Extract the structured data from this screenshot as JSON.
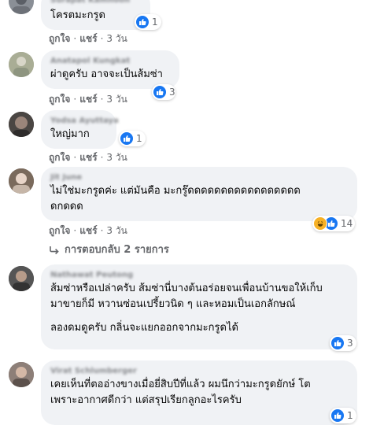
{
  "reactions_icon": "like-icon",
  "colors": {
    "like": "#1877f2",
    "bubble": "#f0f2f5",
    "meta": "#65676b"
  },
  "actions": {
    "like": "ถูกใจ",
    "reply": "แชร์",
    "separator": "·"
  },
  "comments": [
    {
      "name": "Surapat Kamnoon",
      "lines": [
        "โครตมะกรูด"
      ],
      "reaction_count": "1",
      "age": "3 วัน"
    },
    {
      "name": "Anatapol Kungkat",
      "lines": [
        "ผ่าดูครับ อาจจะเป็นส้มซ่า"
      ],
      "reaction_count": "3",
      "age": "3 วัน"
    },
    {
      "name": "Yodsa Ayuttaya",
      "lines": [
        "ใหญ่มาก"
      ],
      "reaction_count": "1",
      "age": "3 วัน"
    },
    {
      "name": "Jit June",
      "lines": [
        "ไม่ใช่มะกรูดค่ะ แต่มันคือ มะกรู๊ดดดดดดดดดดดดดดดดด",
        "ดกดดด"
      ],
      "reaction_count": "14",
      "age": "3 วัน",
      "replies_label": "การตอบกลับ 2 รายการ"
    },
    {
      "name": "Nathawat Peutong",
      "lines": [
        "ส้มซ่าหรือเปล่าครับ ส้มซ่านี่บางต้นอร่อยจนเพื่อนบ้านขอให้เก็บ",
        "มาขายก็มี หวานซ่อนเปรี้ยวนิด ๆ และหอมเป็นเอกลักษณ์"
      ],
      "extra_line": "ลองดมดูครับ กลิ่นจะแยกออกจากมะกรูดได้",
      "reaction_count": "3"
    },
    {
      "name": "Virat Schlumberger",
      "lines": [
        "เคยเห็นที่ตออ่างขางเมื่อยี่สิบปีที่แล้ว ผมนึกว่ามะกรูดยักษ์ โต",
        "เพราะอากาศดีกว่า แต่สรุปเรียกลูกอะไรครับ"
      ],
      "reaction_count": "1"
    }
  ]
}
